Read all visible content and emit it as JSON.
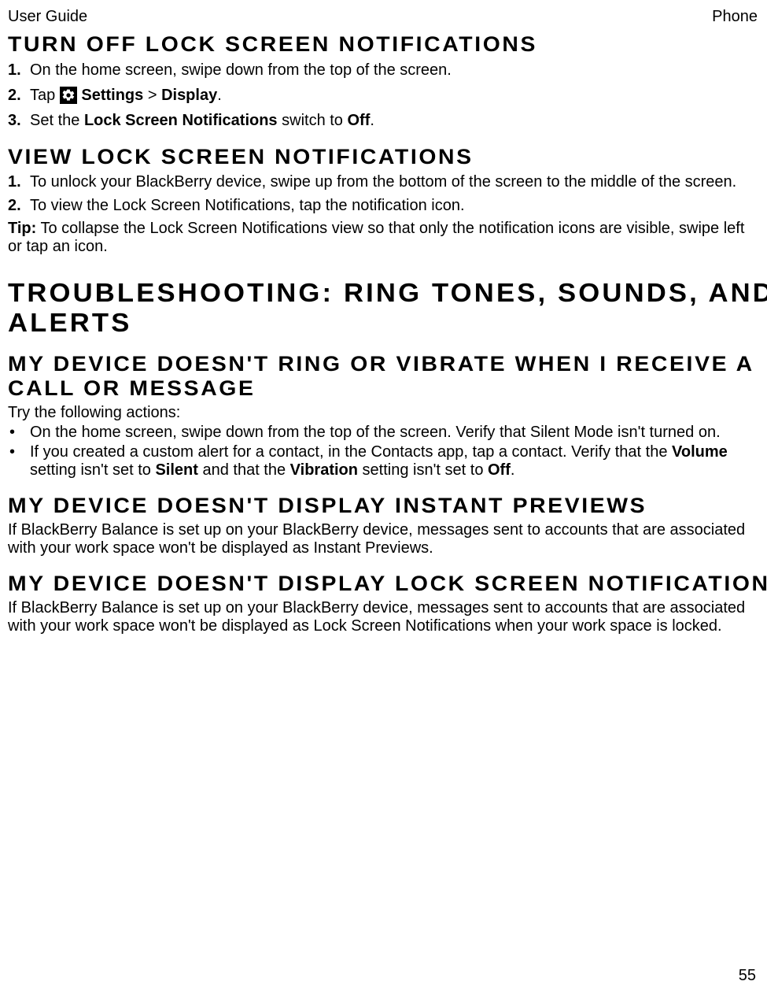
{
  "header": {
    "left": "User Guide",
    "right": "Phone"
  },
  "section1": {
    "title": "TURN OFF LOCK SCREEN NOTIFICATIONS",
    "steps": {
      "a": "On the home screen, swipe down from the top of the screen.",
      "b_pre": "Tap ",
      "b_settings": " Settings",
      "b_gt": " > ",
      "b_display": "Display",
      "b_end": ".",
      "c_pre": "Set the ",
      "c_lsn": "Lock Screen Notifications",
      "c_mid": " switch to ",
      "c_off": "Off",
      "c_end": "."
    }
  },
  "section2": {
    "title": "VIEW LOCK SCREEN NOTIFICATIONS",
    "steps": {
      "a": "To unlock your BlackBerry device, swipe up from the bottom of the screen to the middle of the screen.",
      "b": "To view the Lock Screen Notifications, tap the notification icon."
    },
    "tip_label": "Tip:",
    "tip_body": " To collapse the Lock Screen Notifications view so that only the notification icons are visible, swipe left or tap an icon."
  },
  "section3": {
    "title": "TROUBLESHOOTING: RING TONES, SOUNDS, AND ALERTS",
    "sub1": {
      "title": "MY DEVICE DOESN'T RING OR VIBRATE WHEN I RECEIVE A CALL OR MESSAGE",
      "intro": "Try the following actions:",
      "b1": "On the home screen, swipe down from the top of the screen. Verify that Silent Mode isn't turned on.",
      "b2_pre": "If you created a custom alert for a contact, in the Contacts app, tap a contact. Verify that the ",
      "b2_volume": "Volume",
      "b2_mid1": " setting isn't set to ",
      "b2_silent": "Silent",
      "b2_mid2": " and that the ",
      "b2_vibration": "Vibration",
      "b2_mid3": " setting isn't set to ",
      "b2_off": "Off",
      "b2_end": "."
    },
    "sub2": {
      "title": "MY DEVICE DOESN'T DISPLAY INSTANT PREVIEWS",
      "body": "If BlackBerry Balance is set up on your BlackBerry device, messages sent to accounts that are associated with your work space won't be displayed as Instant Previews."
    },
    "sub3": {
      "title": "MY DEVICE DOESN'T DISPLAY LOCK SCREEN NOTIFICATIONS",
      "body": "If BlackBerry Balance is set up on your BlackBerry device, messages sent to accounts that are associated with your work space won't be displayed as Lock Screen Notifications when your work space is locked."
    }
  },
  "page_number": "55"
}
